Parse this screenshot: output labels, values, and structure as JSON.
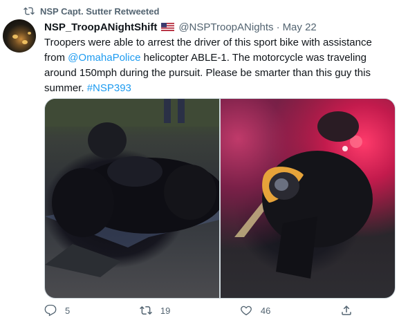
{
  "social_context": {
    "text": "NSP Capt. Sutter Retweeted",
    "icon": "retweet-icon"
  },
  "tweet": {
    "display_name": "NSP_TroopANightShift",
    "handle": "@NSPTroopANights",
    "separator": "·",
    "date": "May 22",
    "text": {
      "part1": "Troopers were able to arrest the driver of this sport bike with assistance from ",
      "mention": "@OmahaPolice",
      "part2": " helicopter ABLE-1.  The motorcycle was traveling around 150mph during the pursuit.  Please be smarter than this guy this summer. ",
      "hashtag": "#NSP393"
    }
  },
  "actions": {
    "reply_count": "5",
    "retweet_count": "19",
    "like_count": "46"
  },
  "colors": {
    "link": "#1d9bf0",
    "secondary_text": "#536471"
  }
}
